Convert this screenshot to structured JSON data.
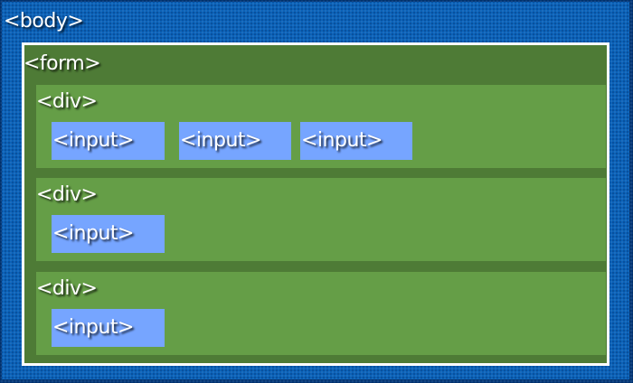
{
  "diagram": {
    "body": {
      "tag": "<body>"
    },
    "form": {
      "tag": "<form>"
    },
    "divs": [
      {
        "tag": "<div>",
        "inputs": [
          "<input>",
          "<input>",
          "<input>"
        ]
      },
      {
        "tag": "<div>",
        "inputs": [
          "<input>"
        ]
      },
      {
        "tag": "<div>",
        "inputs": [
          "<input>"
        ]
      }
    ]
  },
  "colors": {
    "body_fill": "#0b62b8",
    "form_fill": "#4e7b36",
    "div_fill": "#659e47",
    "input_fill": "#76a5ff",
    "label_text": "#ffffff"
  }
}
